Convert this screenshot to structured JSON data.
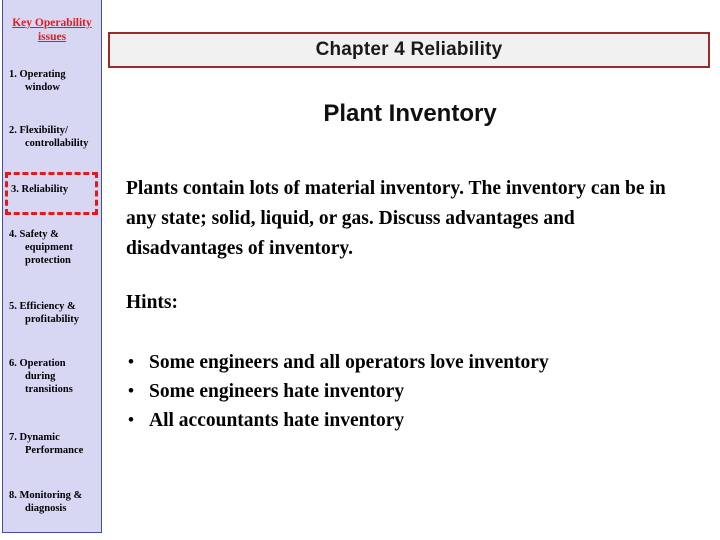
{
  "sidebar": {
    "title": "Key Operability issues",
    "title_color": "#e01b1b",
    "background_color": "#d7d7f4",
    "border_color": "#4a4aa8",
    "highlight_color": "#e01b1b",
    "items": [
      {
        "number": "1.",
        "label": "Operating",
        "label2": "window"
      },
      {
        "number": "2.",
        "label": "Flexibility/",
        "label2": "controllability"
      },
      {
        "number": "3.",
        "label": "Reliability",
        "label2": ""
      },
      {
        "number": "4.",
        "label": "Safety &",
        "label2": "equipment",
        "label3": "protection"
      },
      {
        "number": "5.",
        "label": "Efficiency &",
        "label2": "profitability"
      },
      {
        "number": "6.",
        "label": "Operation",
        "label2": "during",
        "label3": "transitions"
      },
      {
        "number": "7.",
        "label": "Dynamic",
        "label2": "Performance"
      },
      {
        "number": "8.",
        "label": "Monitoring &",
        "label2": "diagnosis"
      }
    ],
    "selected_item": "3. Reliability"
  },
  "header": {
    "title": "Chapter 4 Reliability",
    "background_color": "#f1f1f1",
    "border_color": "#9c2a2a"
  },
  "main": {
    "heading": "Plant Inventory",
    "paragraph": "Plants contain lots of material inventory.  The inventory can be in any state; solid, liquid, or gas.  Discuss advantages and disadvantages of inventory.",
    "hints_label": "Hints:",
    "bullet_glyph": "•",
    "bullets": [
      "Some engineers and all operators love inventory",
      "Some engineers hate inventory",
      "All accountants hate inventory"
    ]
  }
}
